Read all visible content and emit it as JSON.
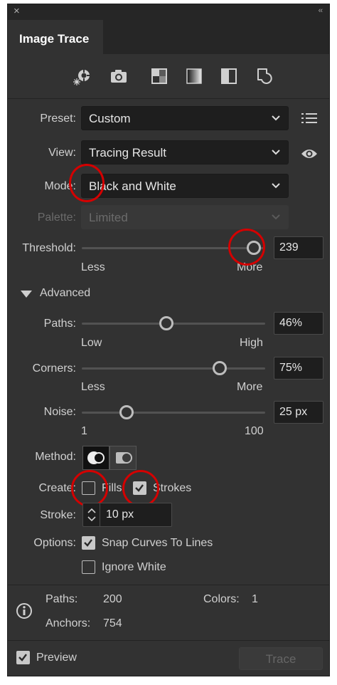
{
  "titlebar": {
    "close_glyph": "×",
    "collapse_glyph": "‹‹"
  },
  "tab": {
    "label": "Image Trace"
  },
  "presets_icons": [
    "auto-color-icon",
    "high-color-photo-icon",
    "low-color-icon",
    "grayscale-icon",
    "black-and-white-icon",
    "outline-icon"
  ],
  "preset": {
    "label": "Preset:",
    "value": "Custom"
  },
  "view": {
    "label": "View:",
    "value": "Tracing Result"
  },
  "mode": {
    "label": "Mode:",
    "value": "Black and White"
  },
  "palette": {
    "label": "Palette:",
    "value": "Limited"
  },
  "threshold": {
    "label": "Threshold:",
    "value": "239",
    "level": 239,
    "min_label": "Less",
    "max_label": "More"
  },
  "advanced": {
    "label": "Advanced"
  },
  "paths": {
    "label": "Paths:",
    "value": "46%",
    "level": 46,
    "min_label": "Low",
    "max_label": "High"
  },
  "corners": {
    "label": "Corners:",
    "value": "75%",
    "level": 75,
    "min_label": "Less",
    "max_label": "More"
  },
  "noise": {
    "label": "Noise:",
    "value": "25 px",
    "level": 25,
    "min_label": "1",
    "max_label": "100"
  },
  "method": {
    "label": "Method:",
    "selected": "abutting"
  },
  "create": {
    "label": "Create:",
    "fills_label": "Fills",
    "fills_checked": false,
    "strokes_label": "Strokes",
    "strokes_checked": true
  },
  "stroke": {
    "label": "Stroke:",
    "value": "10 px"
  },
  "options": {
    "label": "Options:",
    "snap_label": "Snap Curves To Lines",
    "snap_checked": true,
    "ignore_white_label": "Ignore White",
    "ignore_white_checked": false
  },
  "info": {
    "paths_label": "Paths:",
    "paths_value": "200",
    "colors_label": "Colors:",
    "colors_value": "1",
    "anchors_label": "Anchors:",
    "anchors_value": "754"
  },
  "footer": {
    "preview_label": "Preview",
    "preview_checked": true,
    "trace_label": "Trace"
  },
  "colors": {
    "panel_bg": "#323232",
    "field_bg": "#1e1e1e",
    "highlight_ring": "#d40000"
  }
}
